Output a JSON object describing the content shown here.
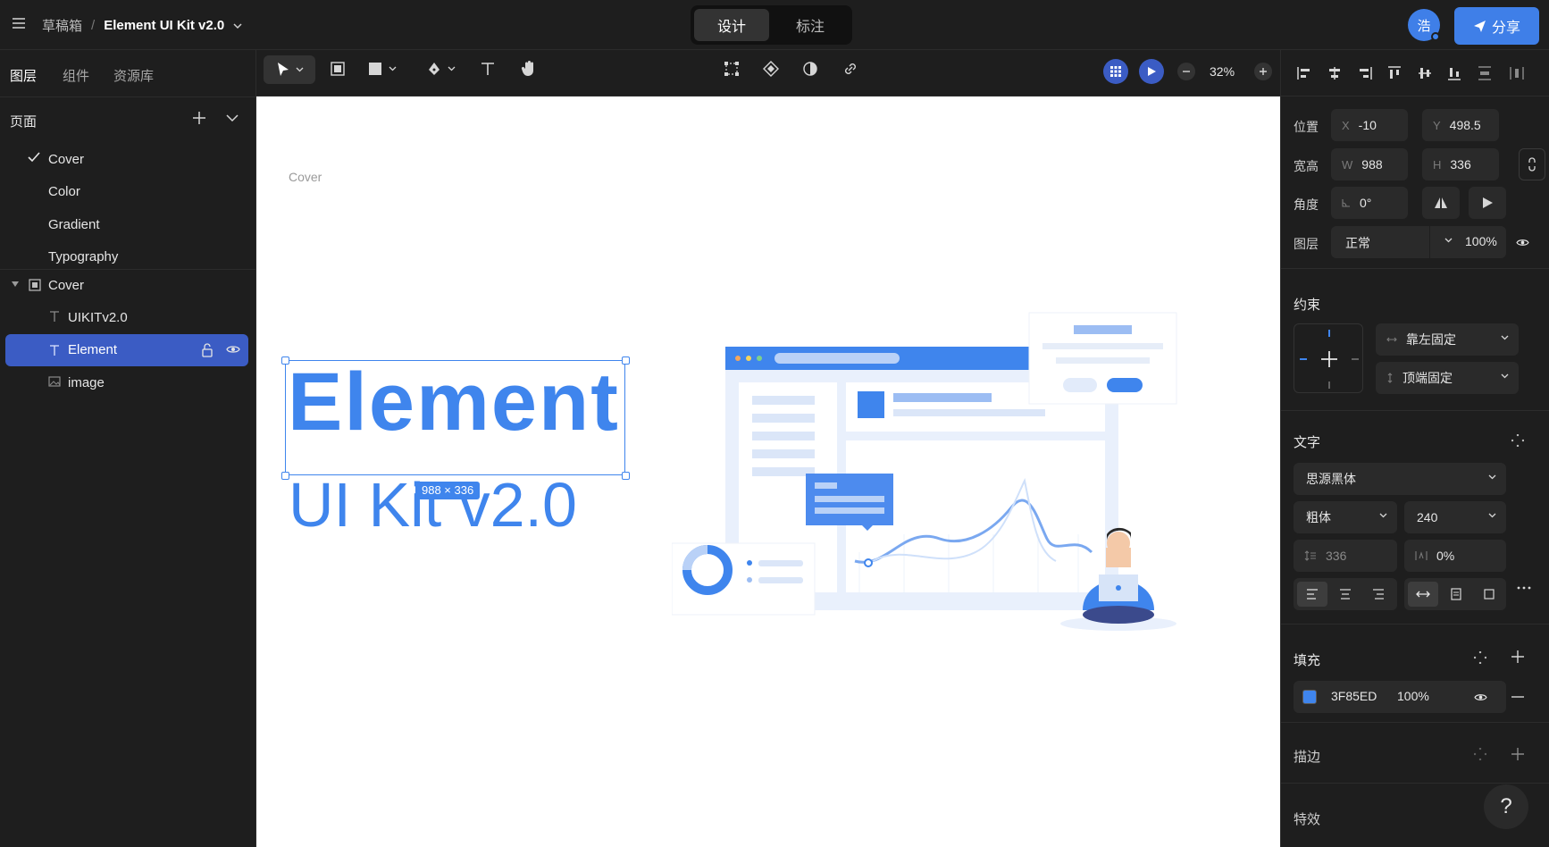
{
  "header": {
    "breadcrumb_root": "草稿箱",
    "separator": "/",
    "file_title": "Element UI Kit v2.0",
    "mode_tabs": [
      "设计",
      "标注"
    ],
    "active_mode": "设计",
    "user_initial": "浩",
    "share_label": "分享",
    "accent": "#3F7FE8"
  },
  "left_panel": {
    "tabs": [
      "图层",
      "组件",
      "资源库"
    ],
    "pages_title": "页面",
    "pages": [
      {
        "label": "Cover",
        "checked": true
      },
      {
        "label": "Color",
        "checked": false
      },
      {
        "label": "Gradient",
        "checked": false
      },
      {
        "label": "Typography",
        "checked": false
      }
    ],
    "layers": [
      {
        "label": "Cover",
        "icon": "frame-icon",
        "level": 0
      },
      {
        "label": "UIKITv2.0",
        "icon": "text-icon",
        "level": 1
      },
      {
        "label": "Element",
        "icon": "text-icon",
        "level": 1,
        "selected": true
      },
      {
        "label": "image",
        "icon": "image-icon",
        "level": 1
      }
    ]
  },
  "toolbar": {
    "zoom": "32%"
  },
  "canvas": {
    "frame_label": "Cover",
    "headline": "Element",
    "subline": "UI Kit v2.0",
    "selection_size": "988 × 336"
  },
  "right_panel": {
    "position_label": "位置",
    "x_prefix": "X",
    "x_value": "-10",
    "y_prefix": "Y",
    "y_value": "498.5",
    "size_label": "宽高",
    "w_prefix": "W",
    "w_value": "988",
    "h_prefix": "H",
    "h_value": "336",
    "angle_label": "角度",
    "angle_value": "0°",
    "layer_label": "图层",
    "blend_mode": "正常",
    "opacity": "100%",
    "constraints_title": "约束",
    "constraint_h": "靠左固定",
    "constraint_v": "顶端固定",
    "text_title": "文字",
    "font_family": "思源黑体",
    "font_weight": "粗体",
    "font_size": "240",
    "line_height": "336",
    "letter_spacing": "0%",
    "fill_title": "填充",
    "fill_hex": "3F85ED",
    "fill_color": "#3F85ED",
    "fill_opacity": "100%",
    "stroke_title": "描边",
    "effects_title": "特效",
    "help_label": "?"
  }
}
